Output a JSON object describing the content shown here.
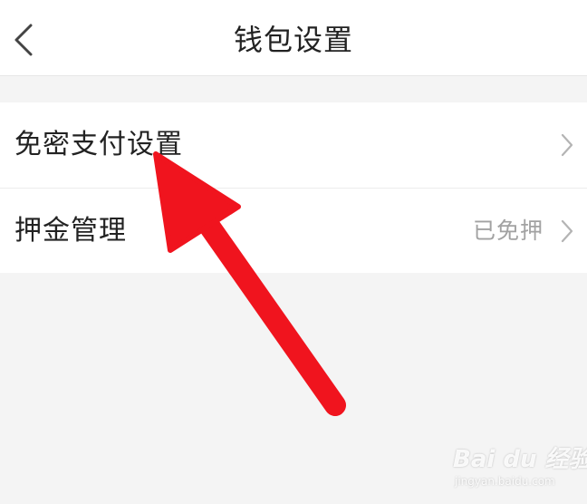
{
  "header": {
    "title": "钱包设置",
    "back_icon": "chevron-left-icon"
  },
  "rows": [
    {
      "label": "免密支付设置",
      "value": "",
      "icon": "chevron-right-icon"
    },
    {
      "label": "押金管理",
      "value": "已免押",
      "icon": "chevron-right-icon"
    }
  ],
  "annotation": {
    "type": "arrow",
    "color": "#f0141e"
  },
  "watermark": {
    "brand": "Bai du 经验",
    "url": "jingyan.baidu.com"
  },
  "colors": {
    "background": "#f4f4f4",
    "surface": "#ffffff",
    "text": "#222222",
    "secondary_text": "#a2a2a2",
    "chevron": "#b4b4b4"
  }
}
